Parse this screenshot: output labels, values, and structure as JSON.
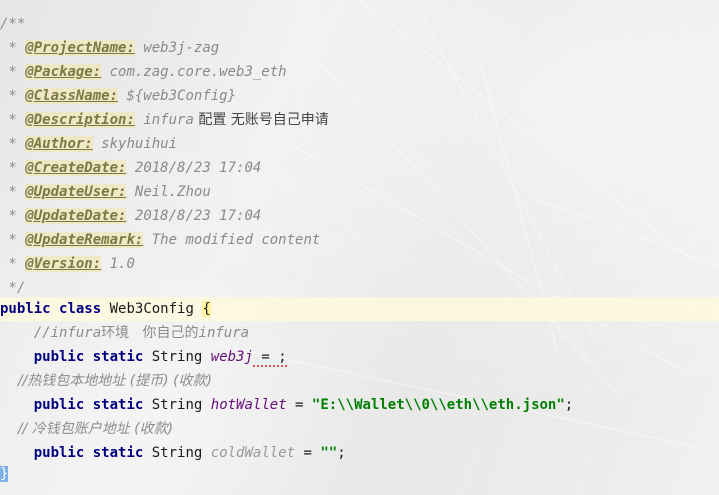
{
  "doc_comment": {
    "open": "/**",
    "close": " */",
    "entries": [
      {
        "tag": "@ProjectName:",
        "value": "web3j-zag"
      },
      {
        "tag": "@Package:",
        "value": "com.zag.core.web3_eth"
      },
      {
        "tag": "@ClassName:",
        "value": "${web3Config}"
      },
      {
        "tag": "@Description:",
        "value_a": "infura",
        "value_b": " 配置 无账号自己申请"
      },
      {
        "tag": "@Author:",
        "value": "skyhuihui"
      },
      {
        "tag": "@CreateDate:",
        "value": "2018/8/23 17:04"
      },
      {
        "tag": "@UpdateUser:",
        "value": "Neil.Zhou"
      },
      {
        "tag": "@UpdateDate:",
        "value": "2018/8/23 17:04"
      },
      {
        "tag": "@UpdateRemark:",
        "value": "The modified content"
      },
      {
        "tag": "@Version:",
        "value": "1.0"
      }
    ]
  },
  "class_decl": {
    "kw_public": "public",
    "kw_class": "class",
    "name": "Web3Config",
    "open_brace": "{",
    "close_brace": "}"
  },
  "body": {
    "comment1": {
      "prefix": "//",
      "a": "infura",
      "b": "环境   你自己的",
      "c": "infura"
    },
    "line_web3j": {
      "kw1": "public",
      "kw2": "static",
      "type": "String",
      "field": "web3j",
      "rest": " = ;"
    },
    "comment2": "//热钱包本地地址 (提币) (收款)",
    "line_hot": {
      "kw1": "public",
      "kw2": "static",
      "type": "String",
      "field": "hotWallet",
      "eq": " = ",
      "string": "\"E:\\\\Wallet\\\\0\\\\eth\\\\eth.json\"",
      "semi": ";"
    },
    "comment3": "// 冷钱包账户地址 (收款)",
    "line_cold": {
      "kw1": "public",
      "kw2": "static",
      "type": "String",
      "field": "coldWallet",
      "eq": " = ",
      "string": "\"\"",
      "semi": ";"
    }
  }
}
